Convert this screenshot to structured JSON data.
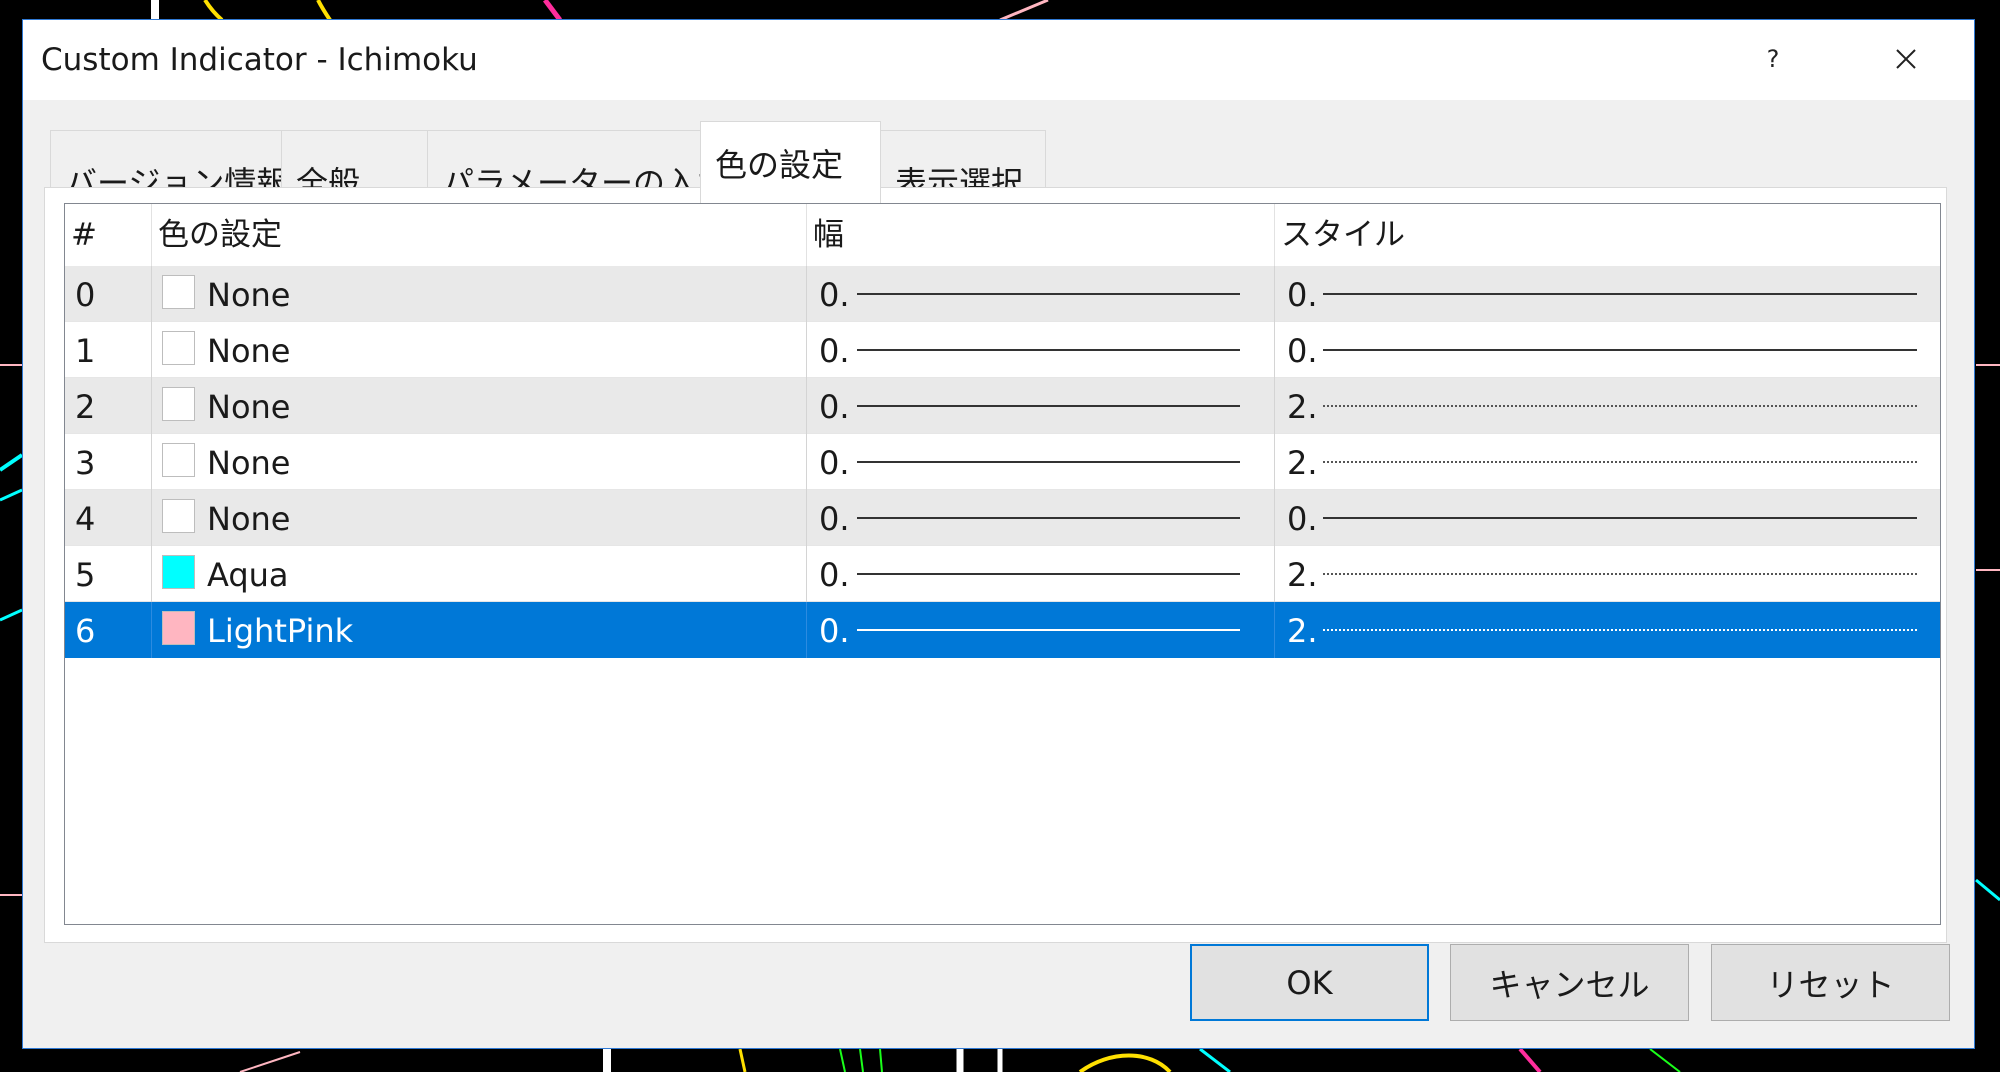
{
  "window": {
    "title": "Custom Indicator - Ichimoku",
    "help_label": "?"
  },
  "tabs": [
    {
      "label": "バージョン情報"
    },
    {
      "label": "全般"
    },
    {
      "label": "パラメーターの入力"
    },
    {
      "label": "色の設定"
    },
    {
      "label": "表示選択"
    }
  ],
  "active_tab": "色の設定",
  "table": {
    "columns": [
      "#",
      "色の設定",
      "幅",
      "スタイル"
    ],
    "rows": [
      {
        "index": "0",
        "color_name": "None",
        "color_hex": "#ffffff",
        "width": "0.",
        "style": "0.",
        "style_type": "solid"
      },
      {
        "index": "1",
        "color_name": "None",
        "color_hex": "#ffffff",
        "width": "0.",
        "style": "0.",
        "style_type": "solid"
      },
      {
        "index": "2",
        "color_name": "None",
        "color_hex": "#ffffff",
        "width": "0.",
        "style": "2.",
        "style_type": "dotted"
      },
      {
        "index": "3",
        "color_name": "None",
        "color_hex": "#ffffff",
        "width": "0.",
        "style": "2.",
        "style_type": "dotted"
      },
      {
        "index": "4",
        "color_name": "None",
        "color_hex": "#ffffff",
        "width": "0.",
        "style": "0.",
        "style_type": "solid"
      },
      {
        "index": "5",
        "color_name": "Aqua",
        "color_hex": "#00ffff",
        "width": "0.",
        "style": "2.",
        "style_type": "dotted"
      },
      {
        "index": "6",
        "color_name": "LightPink",
        "color_hex": "#ffb6c1",
        "width": "0.",
        "style": "2.",
        "style_type": "dotted"
      }
    ],
    "selected_row": "6"
  },
  "buttons": {
    "ok": "OK",
    "cancel": "キャンセル",
    "reset": "リセット"
  },
  "colors": {
    "selection": "#0078d7",
    "accent_border": "#2f79d4"
  }
}
